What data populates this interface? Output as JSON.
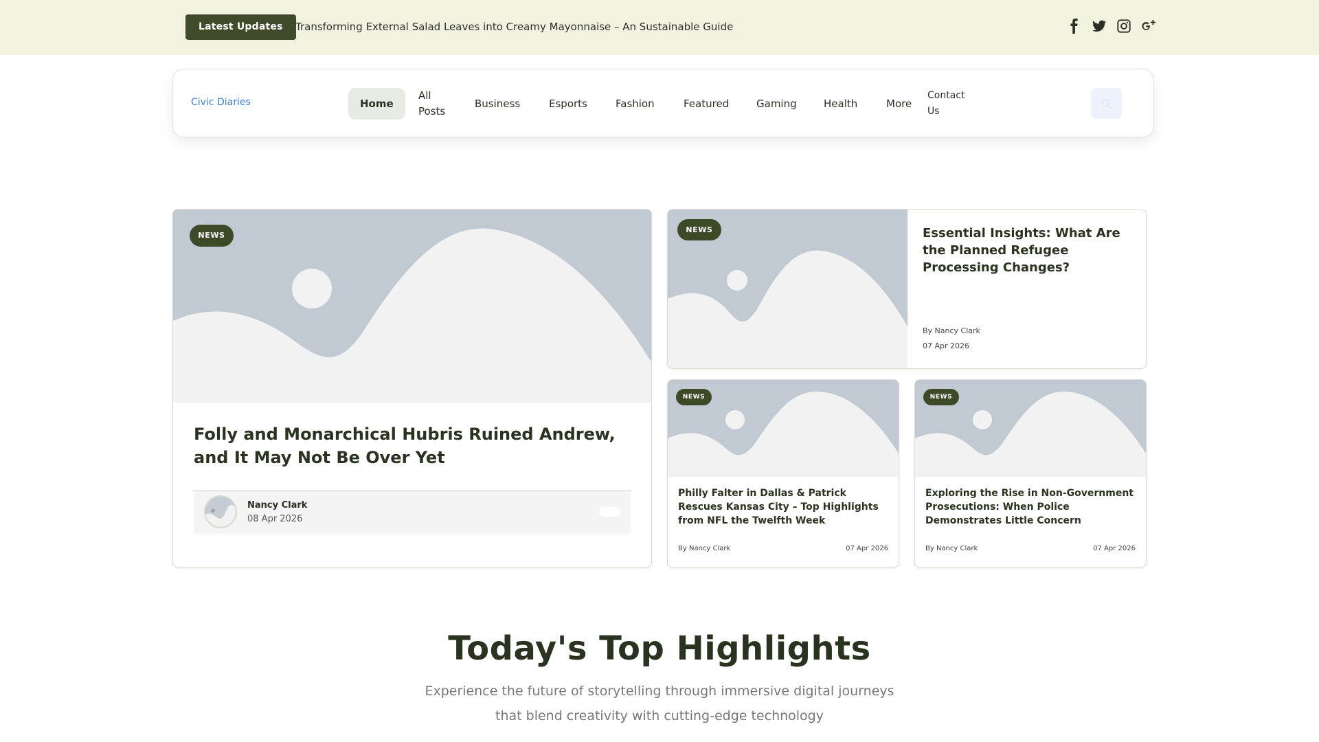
{
  "topbar": {
    "latest_label": "Latest Updates",
    "ticker_text": "Transforming External Salad Leaves into Creamy Mayonnaise – An Sustainable Guide",
    "socials": [
      "facebook-icon",
      "twitter-icon",
      "instagram-icon",
      "google-plus-icon"
    ]
  },
  "nav": {
    "brand": "Civic Diaries",
    "items": [
      "Home",
      "All Posts",
      "Business",
      "Esports",
      "Fashion",
      "Featured",
      "Gaming",
      "Health",
      "More",
      "Contact Us"
    ],
    "active": "Home"
  },
  "featured": {
    "badge": "NEWS",
    "title": "Folly and Monarchical Hubris Ruined Andrew, and It May Not Be Over Yet",
    "author": "Nancy Clark",
    "date": "08 Apr 2026"
  },
  "wide_card": {
    "badge": "NEWS",
    "title": "Essential Insights: What Are the Planned Refugee Processing Changes?",
    "by": "By Nancy Clark",
    "date": "07 Apr 2026"
  },
  "small_cards": [
    {
      "badge": "NEWS",
      "title": "Philly Falter in Dallas & Patrick Rescues Kansas City – Top Highlights from NFL the Twelfth Week",
      "by": "By Nancy Clark",
      "date": "07 Apr 2026"
    },
    {
      "badge": "NEWS",
      "title": "Exploring the Rise in Non-Government Prosecutions: When Police Demonstrates Little Concern",
      "by": "By Nancy Clark",
      "date": "07 Apr 2026"
    }
  ],
  "highlights": {
    "title": "Today's Top Highlights",
    "subtitle_line1": "Experience the future of storytelling through immersive digital journeys",
    "subtitle_line2": "that blend creativity with cutting-edge technology"
  },
  "colors": {
    "topbar_bg": "#f3f1df",
    "accent": "#3f4b2a",
    "brand_link": "#3b82d6",
    "placeholder": "#c1c9d2"
  }
}
